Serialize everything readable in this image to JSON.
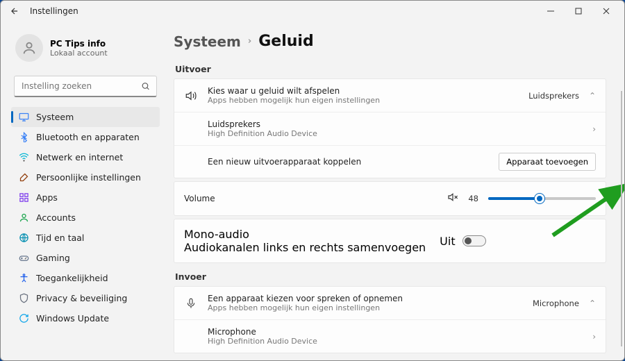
{
  "window_title": "Instellingen",
  "profile": {
    "name": "PC Tips info",
    "sub": "Lokaal account"
  },
  "search_placeholder": "Instelling zoeken",
  "nav": [
    {
      "label": "Systeem",
      "icon": "monitor",
      "color": "#3b82f6",
      "active": true
    },
    {
      "label": "Bluetooth en apparaten",
      "icon": "bluetooth",
      "color": "#3b82f6"
    },
    {
      "label": "Netwerk en internet",
      "icon": "wifi",
      "color": "#06b6d4"
    },
    {
      "label": "Persoonlijke instellingen",
      "icon": "brush",
      "color": "#92400e"
    },
    {
      "label": "Apps",
      "icon": "apps",
      "color": "#7c3aed"
    },
    {
      "label": "Accounts",
      "icon": "person",
      "color": "#16a34a"
    },
    {
      "label": "Tijd en taal",
      "icon": "globe",
      "color": "#0891b2"
    },
    {
      "label": "Gaming",
      "icon": "gamepad",
      "color": "#64748b"
    },
    {
      "label": "Toegankelijkheid",
      "icon": "accessibility",
      "color": "#2563eb"
    },
    {
      "label": "Privacy & beveiliging",
      "icon": "shield",
      "color": "#6b7280"
    },
    {
      "label": "Windows Update",
      "icon": "update",
      "color": "#0ea5e9"
    }
  ],
  "breadcrumb": {
    "parent": "Systeem",
    "current": "Geluid"
  },
  "output_section": "Uitvoer",
  "output_device": {
    "title": "Kies waar u geluid wilt afspelen",
    "sub": "Apps hebben mogelijk hun eigen instellingen",
    "value": "Luidsprekers"
  },
  "speakers": {
    "title": "Luidsprekers",
    "sub": "High Definition Audio Device"
  },
  "pair": {
    "text": "Een nieuw uitvoerapparaat koppelen",
    "button": "Apparaat toevoegen"
  },
  "volume": {
    "label": "Volume",
    "value": 48
  },
  "mono": {
    "title": "Mono-audio",
    "sub": "Audiokanalen links en rechts samenvoegen",
    "state": "Uit"
  },
  "input_section": "Invoer",
  "input_device": {
    "title": "Een apparaat kiezen voor spreken of opnemen",
    "sub": "Apps hebben mogelijk hun eigen instellingen",
    "value": "Microphone"
  },
  "mic": {
    "title": "Microphone",
    "sub": "High Definition Audio Device"
  }
}
